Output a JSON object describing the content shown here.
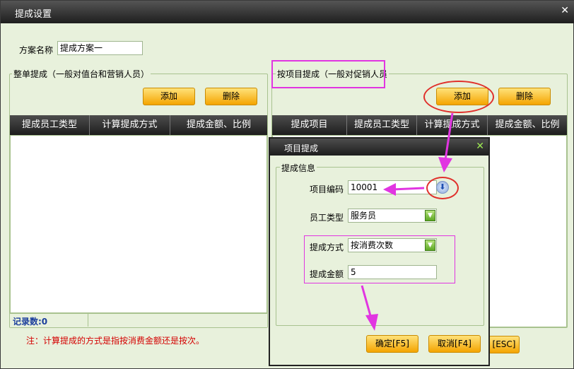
{
  "window": {
    "title": "提成设置",
    "close_icon": "close-icon"
  },
  "scheme": {
    "label": "方案名称",
    "value": "提成方案一"
  },
  "left_group": {
    "title": "整单提成（一般对值台和营销人员）",
    "add_label": "添加",
    "delete_label": "删除",
    "columns": [
      "提成员工类型",
      "计算提成方式",
      "提成金额、比例"
    ],
    "record_count": "记录数:0"
  },
  "right_group": {
    "title": "按项目提成（一般对促销人员",
    "add_label": "添加",
    "delete_label": "删除",
    "columns": [
      "提成项目",
      "提成员工类型",
      "计算提成方式",
      "提成金额、比例"
    ],
    "esc_label": "[ESC]"
  },
  "note": "注：计算提成的方式是指按消费金额还是按次。",
  "dialog": {
    "title": "项目提成",
    "close_icon": "close-icon",
    "group_title": "提成信息",
    "item_code_label": "项目编码",
    "item_code_value": "10001",
    "employee_type_label": "员工类型",
    "employee_type_value": "服务员",
    "method_label": "提成方式",
    "method_value": "按消费次数",
    "amount_label": "提成金额",
    "amount_value": "5",
    "ok_label": "确定[F5]",
    "cancel_label": "取消[F4]"
  },
  "colors": {
    "panel_bg": "#e8f1dc",
    "button": "#f4a400",
    "annotation_magenta": "#e135e1",
    "annotation_red": "#e0302b",
    "note_red": "#d40000"
  }
}
